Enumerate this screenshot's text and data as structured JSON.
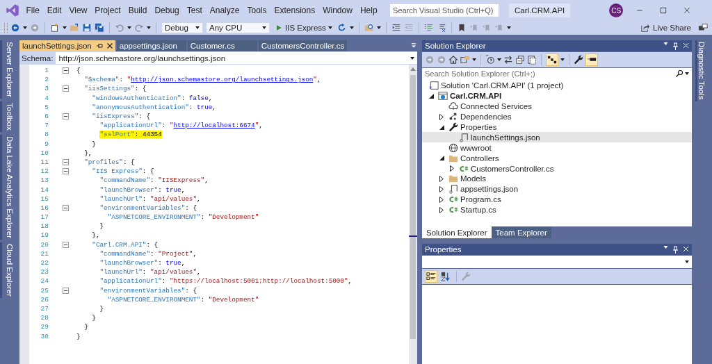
{
  "menu": [
    "File",
    "Edit",
    "View",
    "Project",
    "Build",
    "Debug",
    "Test",
    "Analyze",
    "Tools",
    "Extensions",
    "Window",
    "Help"
  ],
  "search": {
    "placeholder": "Search Visual Studio (Ctrl+Q)"
  },
  "solution_name": "Carl.CRM.API",
  "avatar": "CS",
  "toolbar": {
    "configuration": "Debug",
    "platform": "Any CPU",
    "run_target": "IIS Express",
    "live_share": "Live Share"
  },
  "left_tool_tabs": [
    "Server Explorer",
    "Toolbox",
    "Data Lake Analytics Explorer",
    "Cloud Explorer"
  ],
  "right_tool_tabs": [
    "Diagnostic Tools"
  ],
  "editor": {
    "tabs": [
      {
        "label": "launchSettings.json",
        "selected": true
      },
      {
        "label": "appsettings.json",
        "selected": false
      },
      {
        "label": "Customer.cs",
        "selected": false
      },
      {
        "label": "CustomersController.cs",
        "selected": false
      }
    ],
    "schema": {
      "label": "Schema:",
      "value": "http://json.schemastore.org/launchsettings.json"
    },
    "lines": [
      {
        "number": "1",
        "fold": true,
        "highlighted": false,
        "tokens": [
          {
            "kind": "punct",
            "text": "{"
          }
        ]
      },
      {
        "number": "2",
        "fold": false,
        "highlighted": false,
        "tokens": [
          {
            "kind": "key",
            "text": "  \"$schema\""
          },
          {
            "kind": "punct",
            "text": ": "
          },
          {
            "kind": "string",
            "text": "\""
          },
          {
            "kind": "link",
            "text": "http://json.schemastore.org/launchsettings.json"
          },
          {
            "kind": "string",
            "text": "\""
          },
          {
            "kind": "punct",
            "text": ","
          }
        ]
      },
      {
        "number": "3",
        "fold": true,
        "highlighted": false,
        "tokens": [
          {
            "kind": "key",
            "text": "  \"iisSettings\""
          },
          {
            "kind": "punct",
            "text": ": {"
          }
        ]
      },
      {
        "number": "4",
        "fold": false,
        "highlighted": false,
        "tokens": [
          {
            "kind": "key",
            "text": "    \"windowsAuthentication\""
          },
          {
            "kind": "punct",
            "text": ": "
          },
          {
            "kind": "bool",
            "text": "false"
          },
          {
            "kind": "punct",
            "text": ","
          }
        ]
      },
      {
        "number": "5",
        "fold": false,
        "highlighted": false,
        "tokens": [
          {
            "kind": "key",
            "text": "    \"anonymousAuthentication\""
          },
          {
            "kind": "punct",
            "text": ": "
          },
          {
            "kind": "bool",
            "text": "true"
          },
          {
            "kind": "punct",
            "text": ","
          }
        ]
      },
      {
        "number": "6",
        "fold": true,
        "highlighted": false,
        "tokens": [
          {
            "kind": "key",
            "text": "    \"iisExpress\""
          },
          {
            "kind": "punct",
            "text": ": {"
          }
        ]
      },
      {
        "number": "7",
        "fold": false,
        "highlighted": false,
        "tokens": [
          {
            "kind": "key",
            "text": "      \"applicationUrl\""
          },
          {
            "kind": "punct",
            "text": ": "
          },
          {
            "kind": "string",
            "text": "\""
          },
          {
            "kind": "link",
            "text": "http://localhost:6674"
          },
          {
            "kind": "string",
            "text": "\""
          },
          {
            "kind": "punct",
            "text": ","
          }
        ]
      },
      {
        "number": "8",
        "fold": false,
        "highlighted": true,
        "tokens": [
          {
            "kind": "key",
            "text": "      \"sslPort\""
          },
          {
            "kind": "punct",
            "text": ": "
          },
          {
            "kind": "number",
            "text": "44354"
          }
        ]
      },
      {
        "number": "9",
        "fold": false,
        "highlighted": false,
        "tokens": [
          {
            "kind": "punct",
            "text": "    }"
          }
        ]
      },
      {
        "number": "10",
        "fold": false,
        "highlighted": false,
        "tokens": [
          {
            "kind": "punct",
            "text": "  },"
          }
        ]
      },
      {
        "number": "11",
        "fold": true,
        "highlighted": false,
        "tokens": [
          {
            "kind": "key",
            "text": "  \"profiles\""
          },
          {
            "kind": "punct",
            "text": ": {"
          }
        ]
      },
      {
        "number": "12",
        "fold": true,
        "highlighted": false,
        "tokens": [
          {
            "kind": "key",
            "text": "    \"IIS Express\""
          },
          {
            "kind": "punct",
            "text": ": {"
          }
        ]
      },
      {
        "number": "13",
        "fold": false,
        "highlighted": false,
        "tokens": [
          {
            "kind": "key",
            "text": "      \"commandName\""
          },
          {
            "kind": "punct",
            "text": ": "
          },
          {
            "kind": "string",
            "text": "\"IISExpress\""
          },
          {
            "kind": "punct",
            "text": ","
          }
        ]
      },
      {
        "number": "14",
        "fold": false,
        "highlighted": false,
        "tokens": [
          {
            "kind": "key",
            "text": "      \"launchBrowser\""
          },
          {
            "kind": "punct",
            "text": ": "
          },
          {
            "kind": "bool",
            "text": "true"
          },
          {
            "kind": "punct",
            "text": ","
          }
        ]
      },
      {
        "number": "15",
        "fold": false,
        "highlighted": false,
        "tokens": [
          {
            "kind": "key",
            "text": "      \"launchUrl\""
          },
          {
            "kind": "punct",
            "text": ": "
          },
          {
            "kind": "string",
            "text": "\"api/values\""
          },
          {
            "kind": "punct",
            "text": ","
          }
        ]
      },
      {
        "number": "16",
        "fold": true,
        "highlighted": false,
        "tokens": [
          {
            "kind": "key",
            "text": "      \"environmentVariables\""
          },
          {
            "kind": "punct",
            "text": ": {"
          }
        ]
      },
      {
        "number": "17",
        "fold": false,
        "highlighted": false,
        "tokens": [
          {
            "kind": "key",
            "text": "        \"ASPNETCORE_ENVIRONMENT\""
          },
          {
            "kind": "punct",
            "text": ": "
          },
          {
            "kind": "string",
            "text": "\"Development\""
          }
        ]
      },
      {
        "number": "18",
        "fold": false,
        "highlighted": false,
        "tokens": [
          {
            "kind": "punct",
            "text": "      }"
          }
        ]
      },
      {
        "number": "19",
        "fold": false,
        "highlighted": false,
        "tokens": [
          {
            "kind": "punct",
            "text": "    },"
          }
        ]
      },
      {
        "number": "20",
        "fold": true,
        "highlighted": false,
        "tokens": [
          {
            "kind": "key",
            "text": "    \"Carl.CRM.API\""
          },
          {
            "kind": "punct",
            "text": ": {"
          }
        ]
      },
      {
        "number": "21",
        "fold": false,
        "highlighted": false,
        "tokens": [
          {
            "kind": "key",
            "text": "      \"commandName\""
          },
          {
            "kind": "punct",
            "text": ": "
          },
          {
            "kind": "string",
            "text": "\"Project\""
          },
          {
            "kind": "punct",
            "text": ","
          }
        ]
      },
      {
        "number": "22",
        "fold": false,
        "highlighted": false,
        "tokens": [
          {
            "kind": "key",
            "text": "      \"launchBrowser\""
          },
          {
            "kind": "punct",
            "text": ": "
          },
          {
            "kind": "bool",
            "text": "true"
          },
          {
            "kind": "punct",
            "text": ","
          }
        ]
      },
      {
        "number": "23",
        "fold": false,
        "highlighted": false,
        "tokens": [
          {
            "kind": "key",
            "text": "      \"launchUrl\""
          },
          {
            "kind": "punct",
            "text": ": "
          },
          {
            "kind": "string",
            "text": "\"api/values\""
          },
          {
            "kind": "punct",
            "text": ","
          }
        ]
      },
      {
        "number": "24",
        "fold": false,
        "highlighted": false,
        "tokens": [
          {
            "kind": "key",
            "text": "      \"applicationUrl\""
          },
          {
            "kind": "punct",
            "text": ": "
          },
          {
            "kind": "string",
            "text": "\"https://localhost:5001;http://localhost:5000\""
          },
          {
            "kind": "punct",
            "text": ","
          }
        ]
      },
      {
        "number": "25",
        "fold": true,
        "highlighted": false,
        "tokens": [
          {
            "kind": "key",
            "text": "      \"environmentVariables\""
          },
          {
            "kind": "punct",
            "text": ": {"
          }
        ]
      },
      {
        "number": "26",
        "fold": false,
        "highlighted": false,
        "tokens": [
          {
            "kind": "key",
            "text": "        \"ASPNETCORE_ENVIRONMENT\""
          },
          {
            "kind": "punct",
            "text": ": "
          },
          {
            "kind": "string",
            "text": "\"Development\""
          }
        ]
      },
      {
        "number": "27",
        "fold": false,
        "highlighted": false,
        "tokens": [
          {
            "kind": "punct",
            "text": "      }"
          }
        ]
      },
      {
        "number": "28",
        "fold": false,
        "highlighted": false,
        "tokens": [
          {
            "kind": "punct",
            "text": "    }"
          }
        ]
      },
      {
        "number": "29",
        "fold": false,
        "highlighted": false,
        "tokens": [
          {
            "kind": "punct",
            "text": "  }"
          }
        ]
      },
      {
        "number": "30",
        "fold": false,
        "highlighted": false,
        "tokens": [
          {
            "kind": "punct",
            "text": "}"
          }
        ]
      }
    ]
  },
  "solution_explorer": {
    "title": "Solution Explorer",
    "search_placeholder": "Search Solution Explorer (Ctrl+;)",
    "toggles": [
      {
        "kind": "tree-view",
        "on": true
      },
      {
        "kind": "preview",
        "on": true
      }
    ],
    "tree": [
      {
        "label": "Solution 'Carl.CRM.API' (1 project)",
        "kind": "solution",
        "selected": false,
        "children": [
          {
            "label": "Carl.CRM.API",
            "kind": "project",
            "expanded": true,
            "selected": false,
            "children": [
              {
                "label": "Connected Services",
                "kind": "cloud",
                "selected": false
              },
              {
                "label": "Dependencies",
                "kind": "dependencies",
                "expanded": false,
                "selected": false
              },
              {
                "label": "Properties",
                "kind": "wrench",
                "expanded": true,
                "selected": false,
                "children": [
                  {
                    "label": "launchSettings.json",
                    "kind": "json",
                    "selected": true
                  }
                ]
              },
              {
                "label": "wwwroot",
                "kind": "globe",
                "selected": false
              },
              {
                "label": "Controllers",
                "kind": "folder",
                "expanded": true,
                "selected": false,
                "children": [
                  {
                    "label": "CustomersController.cs",
                    "kind": "csharp",
                    "expanded": false,
                    "selected": false
                  }
                ]
              },
              {
                "label": "Models",
                "kind": "folder",
                "expanded": false,
                "selected": false
              },
              {
                "label": "appsettings.json",
                "kind": "json",
                "expanded": false,
                "selected": false
              },
              {
                "label": "Program.cs",
                "kind": "csharp",
                "expanded": false,
                "selected": false
              },
              {
                "label": "Startup.cs",
                "kind": "csharp",
                "expanded": false,
                "selected": false
              }
            ]
          }
        ]
      }
    ],
    "bottom_tabs": [
      {
        "label": "Solution Explorer",
        "selected": true
      },
      {
        "label": "Team Explorer",
        "selected": false
      }
    ]
  },
  "properties": {
    "title": "Properties",
    "toolbar": [
      {
        "kind": "categorized",
        "on": true
      },
      {
        "kind": "alphabetical",
        "on": false
      }
    ]
  }
}
